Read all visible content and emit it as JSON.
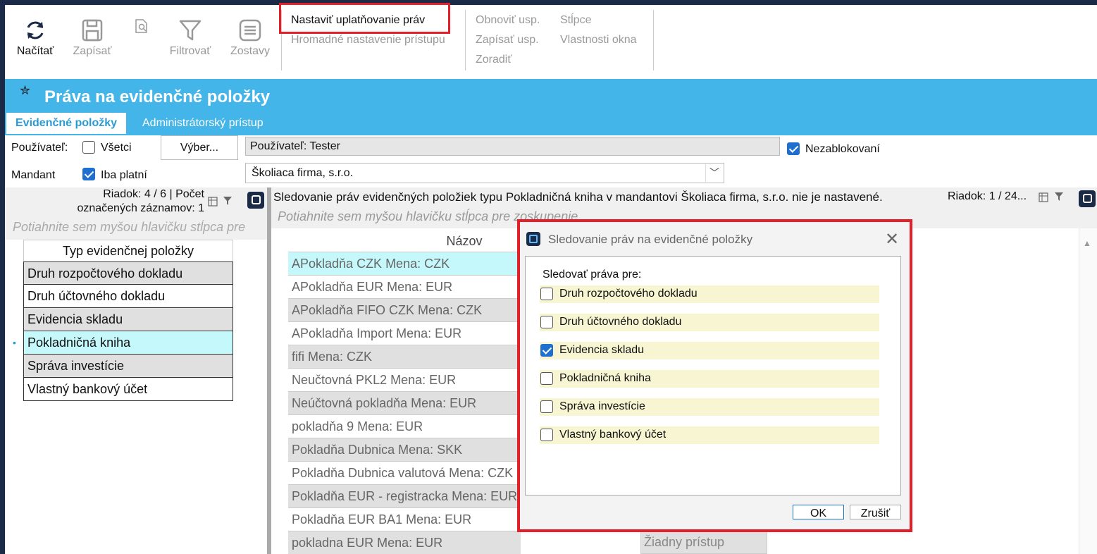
{
  "ribbon": {
    "reload_label": "Načítať",
    "save_label": "Zapísať",
    "filter_label": "Filtrovať",
    "reports_label": "Zostavy",
    "set_rights_label": "Nastaviť uplatňovanie práv",
    "bulk_access_label": "Hromadné nastavenie prístupu",
    "restore_label": "Obnoviť usp.",
    "write_label": "Zapísať usp.",
    "sort_label": "Zoradiť",
    "columns_label": "Stĺpce",
    "window_props_label": "Vlastnosti okna"
  },
  "header": {
    "title": "Práva na evidenčné položky",
    "tabs": [
      "Evidenčné položky",
      "Administrátorský prístup"
    ]
  },
  "filters": {
    "user_label": "Používateľ:",
    "all_label": "Všetci",
    "all_checked": false,
    "select_button": "Výber...",
    "user_value": "Používateľ: Tester",
    "not_blocked_label": "Nezablokovaní",
    "not_blocked_checked": true,
    "mandant_label": "Mandant",
    "only_valid_label": "Iba platní",
    "only_valid_checked": true,
    "mandant_value": "Školiaca firma, s.r.o.",
    "dropdown_arrow": "﹀"
  },
  "left_grid": {
    "status_line1": "Riadok: 4 / 6 | Počet",
    "status_line2": "označených záznamov: 1",
    "group_hint": "Potiahnite sem myšou hlavičku stĺpca pre",
    "column_header": "Typ evidenčnej položky",
    "rows": [
      "Druh rozpočtového dokladu",
      "Druh účtovného dokladu",
      "Evidencia skladu",
      "Pokladničná kniha",
      "Správa investície",
      "Vlastný bankový účet"
    ]
  },
  "right_grid": {
    "status": "Sledovanie práv evidenčných položiek typu Pokladničná kniha v mandantovi Školiaca firma, s.r.o. nie je nastavené.",
    "row_info": "Riadok: 1 / 24...",
    "group_hint": "Potiahnite sem myšou hlavičku stĺpca pre zoskupenie",
    "column_header": "Názov",
    "rows": [
      "APokladňa CZK Mena: CZK",
      "APokladňa EUR Mena: EUR",
      "APokladňa FIFO CZK Mena: CZK",
      "APokladňa Import Mena: EUR",
      "fifi Mena: CZK",
      "Neučtovná PKL2 Mena: EUR",
      "Neúčtovná pokladňa Mena: EUR",
      "pokladňa 9 Mena: EUR",
      "Pokladňa Dubnica Mena: SKK",
      "Pokladňa Dubnica valutová Mena: CZK",
      "Pokladňa EUR - registracka Mena: EUR",
      "Pokladňa EUR BA1 Mena: EUR",
      "pokladna EUR Mena: EUR"
    ],
    "access_value": "Žiadny prístup"
  },
  "dialog": {
    "title": "Sledovanie práv na evidenčné položky",
    "label": "Sledovať práva pre:",
    "options": [
      {
        "label": "Druh rozpočtového dokladu",
        "checked": false
      },
      {
        "label": "Druh účtovného dokladu",
        "checked": false
      },
      {
        "label": "Evidencia skladu",
        "checked": true
      },
      {
        "label": "Pokladničná kniha",
        "checked": false
      },
      {
        "label": "Správa investície",
        "checked": false
      },
      {
        "label": "Vlastný bankový účet",
        "checked": false
      }
    ],
    "ok_label": "OK",
    "cancel_label": "Zrušiť",
    "close_glyph": "✕"
  },
  "colors": {
    "accent": "#44b5e8",
    "highlight": "#e3202a",
    "selected_row": "#c5f8fb"
  }
}
